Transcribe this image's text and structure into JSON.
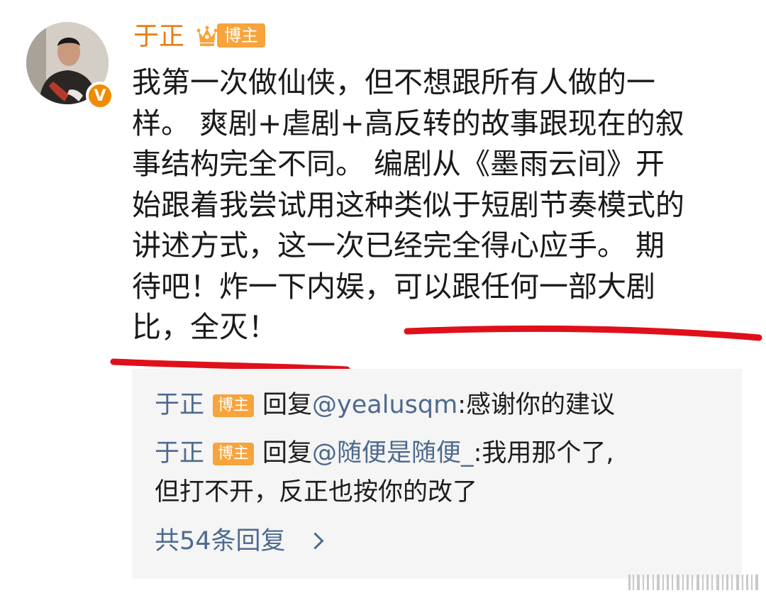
{
  "post": {
    "author": "于正",
    "badge": "博主",
    "lines": [
      "我第一次做仙侠，但不想跟所有人做的一",
      "样。 爽剧+虐剧+高反转的故事跟现在的叙",
      "事结构完全不同。 编剧从《墨雨云间》开",
      "始跟着我尝试用这种类似于短剧节奏模式的",
      "讲述方式，这一次已经完全得心应手。 期",
      "待吧！炸一下内娱，可以跟任何一部大剧",
      "比，全灭！"
    ]
  },
  "replies": [
    {
      "author": "于正",
      "badge": "博主",
      "prefix": "回复",
      "mention": "@yealusqm",
      "text": ":感谢你的建议",
      "continuation": ""
    },
    {
      "author": "于正",
      "badge": "博主",
      "prefix": "回复",
      "mention": "@随便是随便_",
      "text": ":我用那个了,",
      "continuation": "但打不开，反正也按你的改了"
    }
  ],
  "more_replies": "共54条回复",
  "colors": {
    "username": "#ea7c12",
    "badge": "#f6a43b",
    "link": "#4e6a8f",
    "underline": "#e0101a"
  }
}
